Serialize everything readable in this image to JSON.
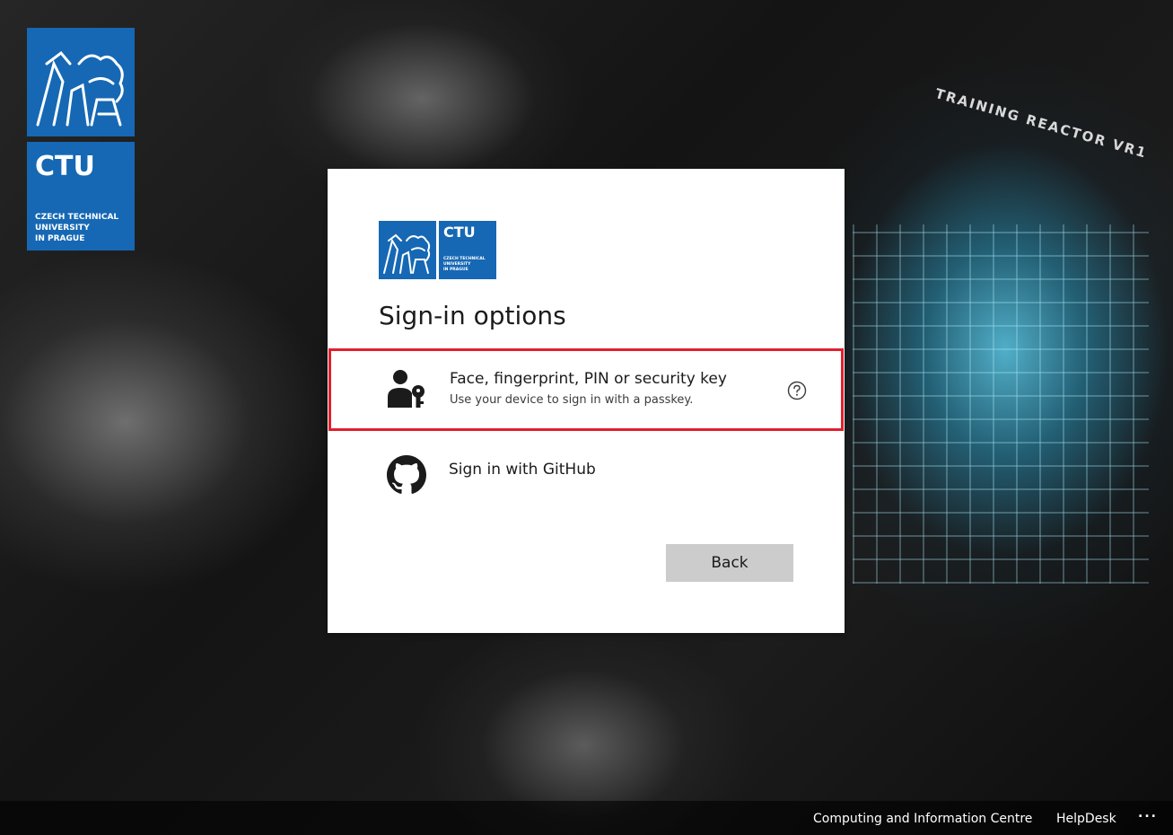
{
  "brand": {
    "short_name": "CTU",
    "full_name": "CZECH TECHNICAL\nUNIVERSITY\nIN PRAGUE",
    "color": "#1668b4"
  },
  "background": {
    "label": "TRAINING REACTOR VR1"
  },
  "dialog": {
    "title": "Sign-in options",
    "options": [
      {
        "icon": "person-key-icon",
        "title": "Face, fingerprint, PIN or security key",
        "subtitle": "Use your device to sign in with a passkey.",
        "help_icon": "help-circle-icon",
        "highlight_color": "#e0202e"
      },
      {
        "icon": "github-icon",
        "title": "Sign in with GitHub"
      }
    ],
    "back_label": "Back"
  },
  "footer": {
    "links": [
      "Computing and Information Centre",
      "HelpDesk"
    ],
    "more": "..."
  }
}
